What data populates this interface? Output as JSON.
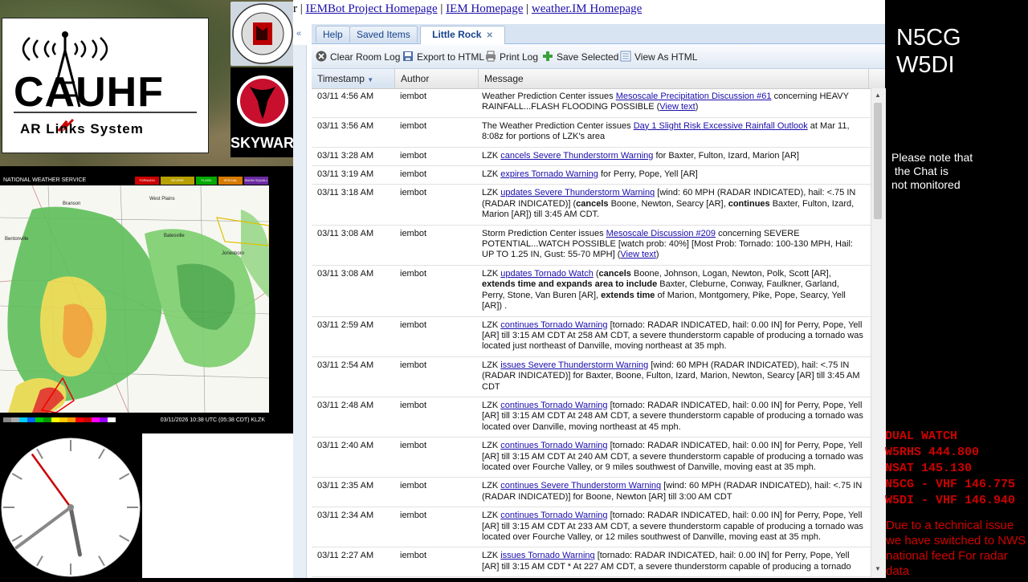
{
  "logos": {
    "cauhf": "CAUHF",
    "aren": "AR  Links System",
    "skywarn": "SKYWARN",
    "seal": "CENTRAL ARKANSAS"
  },
  "radar": {
    "header": "NATIONAL WEATHER SERVICE",
    "legend": [
      "TORNADO",
      "SEVERE THUNDERSTORM",
      "FLASH FLOOD",
      "SPECIAL MARINE",
      "SNOW SQUALL"
    ],
    "timestamp": "03/11/2026 10:38 UTC (05:38 CDT) KLZK",
    "cities": [
      "Branson",
      "West Plains",
      "Bentonville",
      "Jonesboro",
      "Batesville"
    ]
  },
  "clock": {
    "hour": 5,
    "minute": 38,
    "second": 54
  },
  "linkbar": {
    "prefix": "r | ",
    "links": [
      "IEMBot Project Homepage",
      "IEM Homepage",
      "weather.IM Homepage"
    ],
    "sep": " | "
  },
  "tabs": [
    {
      "label": "Help"
    },
    {
      "label": "Saved Items"
    },
    {
      "label": "Little Rock",
      "active": true
    }
  ],
  "toolbar": {
    "clear": "Clear Room Log",
    "export": "Export to HTML",
    "print": "Print Log",
    "save": "Save Selected",
    "view": "View As HTML"
  },
  "columns": {
    "timestamp": "Timestamp",
    "author": "Author",
    "message": "Message"
  },
  "rows": [
    {
      "ts": "03/11 4:56 AM",
      "author": "iembot",
      "pre": "Weather Prediction Center issues ",
      "link": "Mesoscale Precipitation Discussion #61",
      "post": " concerning HEAVY RAINFALL...FLASH FLOODING POSSIBLE (",
      "link2": "View text",
      "post2": ")"
    },
    {
      "ts": "03/11 3:56 AM",
      "author": "iembot",
      "pre": "The Weather Prediction Center issues ",
      "link": "Day 1 Slight Risk Excessive Rainfall Outlook",
      "post": " at Mar 11, 8:08z for portions of LZK's area"
    },
    {
      "ts": "03/11 3:28 AM",
      "author": "iembot",
      "pre": "LZK ",
      "link": "cancels Severe Thunderstorm Warning",
      "post": " for Baxter, Fulton, Izard, Marion [AR]"
    },
    {
      "ts": "03/11 3:19 AM",
      "author": "iembot",
      "pre": "LZK ",
      "link": "expires Tornado Warning",
      "post": " for Perry, Pope, Yell [AR]"
    },
    {
      "ts": "03/11 3:18 AM",
      "author": "iembot",
      "pre": "LZK ",
      "link": "updates Severe Thunderstorm Warning",
      "post": " [wind: 60 MPH (RADAR INDICATED), hail: <.75 IN (RADAR INDICATED)] (",
      "b1": "cancels",
      "mid1": " Boone, Newton, Searcy [AR], ",
      "b2": "continues",
      "mid2": " Baxter, Fulton, Izard, Marion [AR]) till 3:45 AM CDT."
    },
    {
      "ts": "03/11 3:08 AM",
      "author": "iembot",
      "pre": "Storm Prediction Center issues ",
      "link": "Mesoscale Discussion #209",
      "post": " concerning SEVERE POTENTIAL...WATCH POSSIBLE [watch prob: 40%] [Most Prob: Tornado: 100-130 MPH, Hail: UP TO 1.25 IN, Gust: 55-70 MPH] (",
      "link2": "View text",
      "post2": ")"
    },
    {
      "ts": "03/11 3:08 AM",
      "author": "iembot",
      "pre": "LZK ",
      "link": "updates Tornado Watch",
      "post": " (",
      "b1": "cancels",
      "mid1": " Boone, Johnson, Logan, Newton, Polk, Scott [AR], ",
      "b2": "extends time and expands area to include",
      "mid2": " Baxter, Cleburne, Conway, Faulkner, Garland, Perry, Stone, Van Buren [AR], ",
      "b3": "extends time",
      "mid3": " of Marion, Montgomery, Pike, Pope, Searcy, Yell [AR]) ."
    },
    {
      "ts": "03/11 2:59 AM",
      "author": "iembot",
      "pre": "LZK ",
      "link": "continues Tornado Warning",
      "post": " [tornado: RADAR INDICATED, hail: 0.00 IN] for Perry, Pope, Yell [AR] till 3:15 AM CDT At 258 AM CDT, a severe thunderstorm capable of producing a tornado was located just northeast of Danville, moving northeast at 35 mph."
    },
    {
      "ts": "03/11 2:54 AM",
      "author": "iembot",
      "pre": "LZK ",
      "link": "issues Severe Thunderstorm Warning",
      "post": " [wind: 60 MPH (RADAR INDICATED), hail: <.75 IN (RADAR INDICATED)] for Baxter, Boone, Fulton, Izard, Marion, Newton, Searcy [AR] till 3:45 AM CDT"
    },
    {
      "ts": "03/11 2:48 AM",
      "author": "iembot",
      "pre": "LZK ",
      "link": "continues Tornado Warning",
      "post": " [tornado: RADAR INDICATED, hail: 0.00 IN] for Perry, Pope, Yell [AR] till 3:15 AM CDT At 248 AM CDT, a severe thunderstorm capable of producing a tornado was located over Danville, moving northeast at 45 mph."
    },
    {
      "ts": "03/11 2:40 AM",
      "author": "iembot",
      "pre": "LZK ",
      "link": "continues Tornado Warning",
      "post": " [tornado: RADAR INDICATED, hail: 0.00 IN] for Perry, Pope, Yell [AR] till 3:15 AM CDT At 240 AM CDT, a severe thunderstorm capable of producing a tornado was located over Fourche Valley, or 9 miles southwest of Danville, moving east at 35 mph."
    },
    {
      "ts": "03/11 2:35 AM",
      "author": "iembot",
      "pre": "LZK ",
      "link": "continues Severe Thunderstorm Warning",
      "post": " [wind: 60 MPH (RADAR INDICATED), hail: <.75 IN (RADAR INDICATED)] for Boone, Newton [AR] till 3:00 AM CDT"
    },
    {
      "ts": "03/11 2:34 AM",
      "author": "iembot",
      "pre": "LZK ",
      "link": "continues Tornado Warning",
      "post": " [tornado: RADAR INDICATED, hail: 0.00 IN] for Perry, Pope, Yell [AR] till 3:15 AM CDT At 233 AM CDT, a severe thunderstorm capable of producing a tornado was located over Fourche Valley, or 12 miles southwest of Danville, moving east at 35 mph."
    },
    {
      "ts": "03/11 2:27 AM",
      "author": "iembot",
      "pre": "LZK ",
      "link": "issues Tornado Warning",
      "post": " [tornado: RADAR INDICATED, hail: 0.00 IN] for Perry, Pope, Yell [AR] till 3:15 AM CDT * At 227 AM CDT, a severe thunderstorm capable of producing a tornado"
    }
  ],
  "right": {
    "callsigns": [
      "N5CG",
      "W5DI"
    ],
    "chat_note": "Please note that\n the Chat is\nnot monitored",
    "dualwatch": [
      "DUAL WATCH",
      "W5RHS  444.800",
      "NSAT  145.130",
      "N5CG - VHF 146.775",
      "W5DI  - VHF 146.940"
    ],
    "tech_issue": "Due to a technical issue we have switched to NWS national feed For radar data"
  }
}
